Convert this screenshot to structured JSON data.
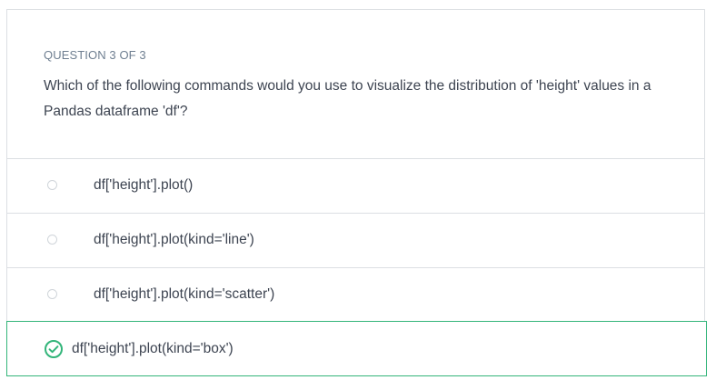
{
  "question": {
    "eyebrow": "QUESTION 3 OF 3",
    "prompt": "Which of the following commands would you use to visualize the distribution of 'height' values in a Pandas dataframe 'df'?"
  },
  "options": [
    {
      "label": "df['height'].plot()",
      "state": "unselected",
      "icon": "radio-icon"
    },
    {
      "label": "df['height'].plot(kind='line')",
      "state": "unselected",
      "icon": "radio-icon"
    },
    {
      "label": "df['height'].plot(kind='scatter')",
      "state": "unselected",
      "icon": "radio-icon"
    },
    {
      "label": "df['height'].plot(kind='box')",
      "state": "correct",
      "icon": "check-circle-icon"
    }
  ],
  "colors": {
    "correct": "#33b57a",
    "text": "#3d4451",
    "eyebrow": "#6f7f91",
    "border": "#dcdfe3"
  }
}
